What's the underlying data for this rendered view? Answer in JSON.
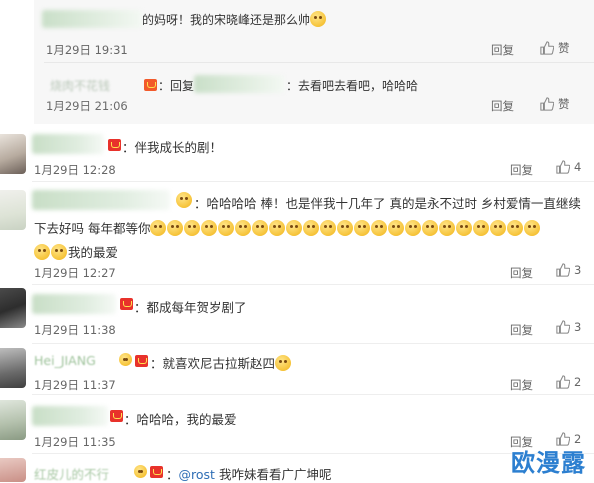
{
  "replies": [
    {
      "text": "的妈呀！我的宋晓峰还是那么帅",
      "time": "1月29日 19:31",
      "reply_label": "回复",
      "like_label": "赞"
    },
    {
      "name": "烧肉不花钱",
      "text_prefix": "：回复",
      "text": "去看吧去看吧，哈哈哈",
      "time": "1月29日 21:06",
      "reply_label": "回复",
      "like_label": "赞"
    }
  ],
  "comments": [
    {
      "text": "：伴我成长的剧！",
      "time": "1月29日 12:28",
      "reply_label": "回复",
      "likes": "4"
    },
    {
      "text": "：哈哈哈哈 棒！也是伴我十几年了 真的是永不过时 乡村爱情一直继续",
      "text2": "下去好吗 每年都等你",
      "text3": "我的最爱",
      "time": "1月29日 12:27",
      "reply_label": "回复",
      "likes": "3"
    },
    {
      "text": "：都成每年贺岁剧了",
      "time": "1月29日 11:38",
      "reply_label": "回复",
      "likes": "3"
    },
    {
      "name": "Hei_JIANG",
      "text": "：就喜欢尼古拉斯赵四",
      "time": "1月29日 11:37",
      "reply_label": "回复",
      "likes": "2"
    },
    {
      "text": "：哈哈哈，我的最爱",
      "time": "1月29日 11:35",
      "reply_label": "回复",
      "likes": "2"
    },
    {
      "name": "红皮儿的不行",
      "mention": "@rost",
      "text": "我咋妹看看广广坤呢"
    }
  ],
  "watermark": "欧漫露",
  "colors": {
    "link": "#2f6eb5",
    "badge": "#e8322b",
    "watermark": "#2c7fd0"
  }
}
